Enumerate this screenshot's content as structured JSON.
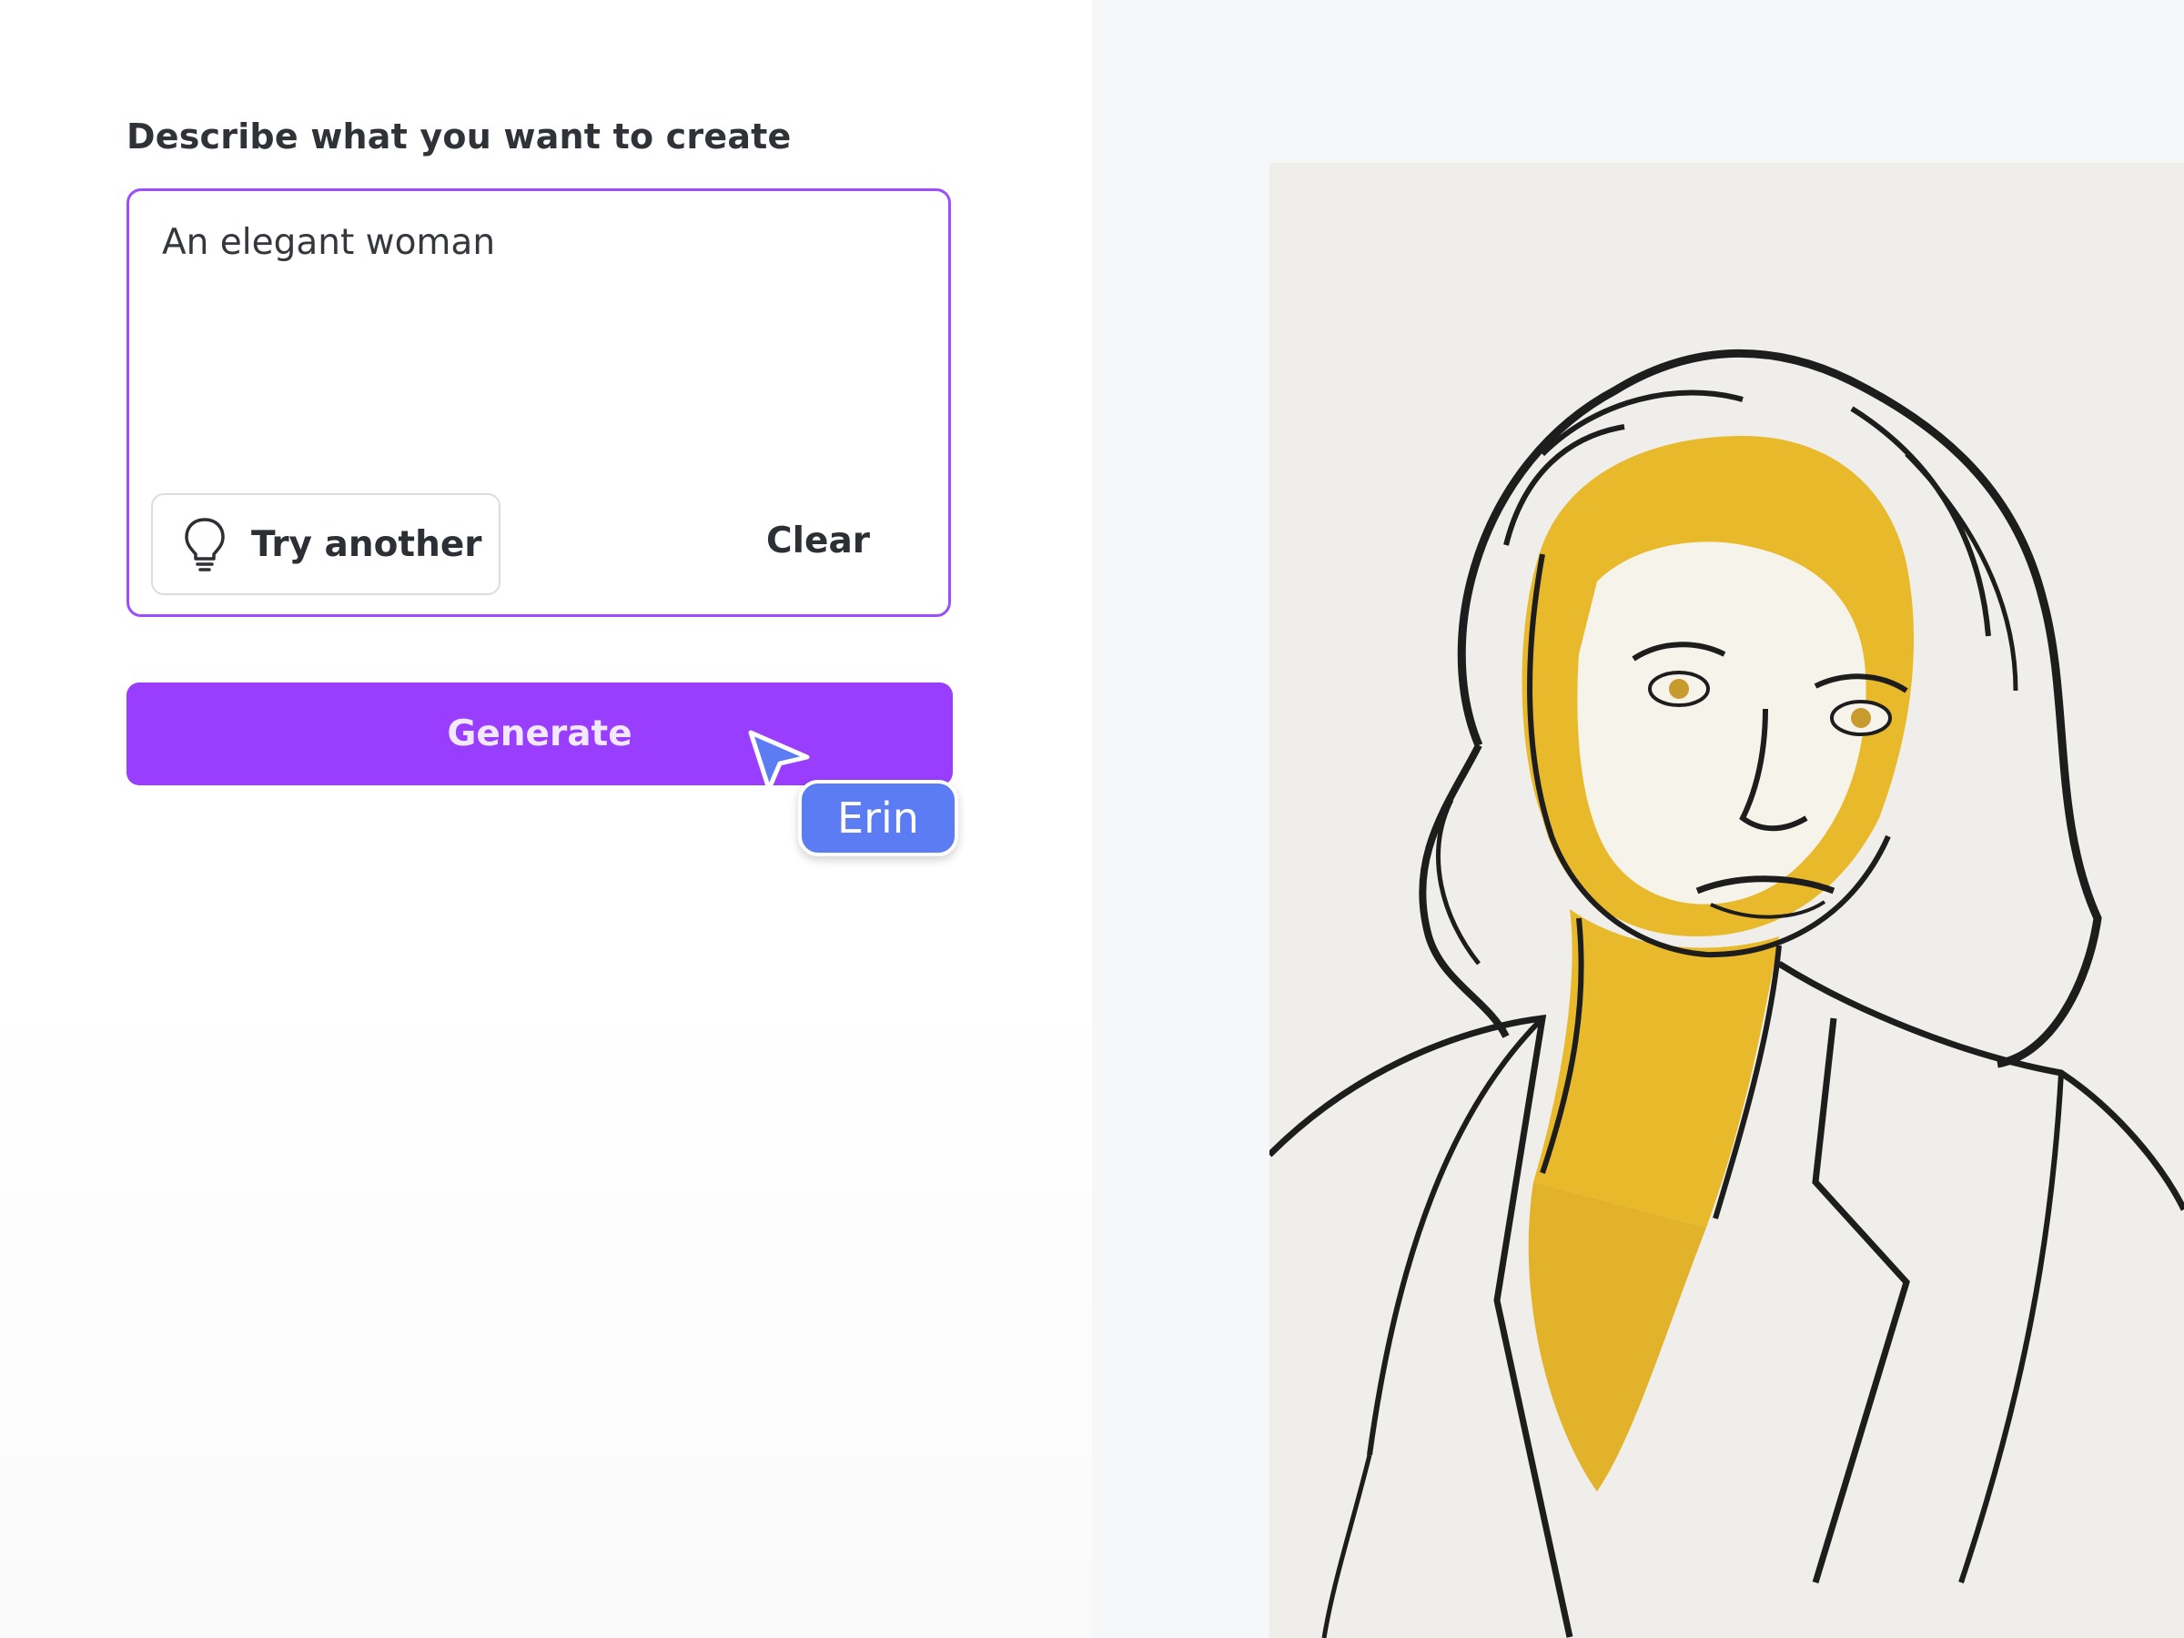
{
  "prompt": {
    "label": "Describe what you want to create",
    "value": "An elegant woman",
    "try_another_label": "Try another",
    "clear_label": "Clear"
  },
  "generate": {
    "label": "Generate"
  },
  "collaborator_cursor": {
    "name": "Erin",
    "color": "#5b7cf3"
  },
  "generated_image": {
    "subject": "line-art portrait with gold accents"
  },
  "colors": {
    "accent": "#993dff",
    "prompt_border": "#9b4dff",
    "gold": "#e8b92a"
  },
  "icons": {
    "try_another": "lightbulb-icon",
    "cursor": "pointer-arrow-icon"
  }
}
